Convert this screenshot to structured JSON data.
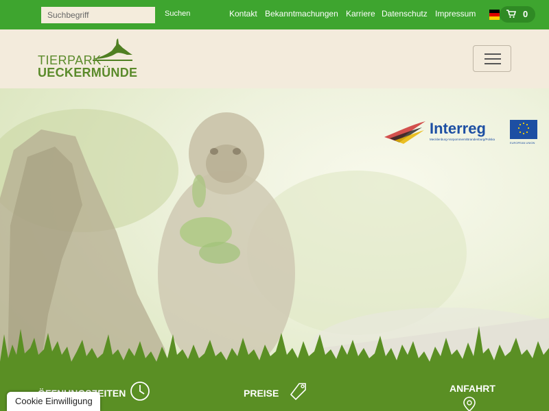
{
  "topbar": {
    "search_placeholder": "Suchbegriff",
    "search_button": "Suchen",
    "links": [
      "Kontakt",
      "Bekanntmachungen",
      "Karriere",
      "Datenschutz",
      "Impressum"
    ],
    "cart_count": "0",
    "language_flag": "de-flag-icon",
    "bg_color": "#3ea52f"
  },
  "header": {
    "logo_line1": "TIERPARK",
    "logo_line2": "UECKERMÜNDE",
    "menu_icon": "hamburger-menu-icon"
  },
  "hero": {
    "image": "monkey-on-tree-stump",
    "interreg": {
      "name": "Interreg",
      "region": "Mecklenburg-Vorpommern/Brandenburg/Polska",
      "eu_label": "EUROPEAN UNION"
    }
  },
  "bottom": {
    "items": [
      {
        "label": "ÖFFNUNGSZEITEN",
        "icon": "clock-icon"
      },
      {
        "label": "PREISE",
        "icon": "price-tag-icon"
      },
      {
        "label": "ANFAHRT",
        "icon": "location-pin-icon"
      }
    ],
    "bg_color": "#5a8f24"
  },
  "cookie_button": "Cookie Einwilligung"
}
